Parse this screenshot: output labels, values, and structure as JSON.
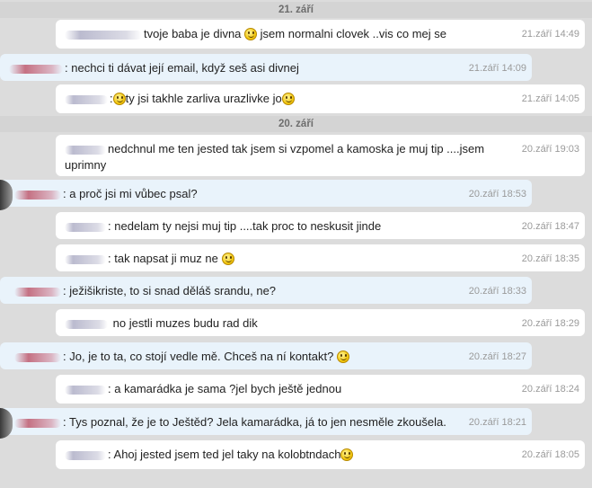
{
  "days": [
    {
      "label": "21. září"
    },
    {
      "label": "20. září"
    }
  ],
  "messages": [
    {
      "dir": "in",
      "prefix": "",
      "text": "tvoje baba je divna",
      "emoji_mid": true,
      "text2": "jsem normalni clovek ..vis co mej se",
      "time": "21.září 14:49"
    },
    {
      "dir": "out",
      "prefix": ":",
      "text": "nechci ti dávat její email, když seš asi divnej",
      "time": "21.září 14:09"
    },
    {
      "dir": "in",
      "prefix": ":",
      "text": "ty jsi takhle zarliva urazlivke jo",
      "time": "21.září 14:05"
    },
    {
      "dir": "in",
      "prefix": "",
      "text": "nedchnul me ten jested tak jsem si vzpomel a kamoska je muj tip ....jsem",
      "text_line2": "uprimny",
      "time": "20.září 19:03"
    },
    {
      "dir": "out",
      "prefix": ":",
      "text": "a proč jsi mi vůbec psal?",
      "time": "20.září 18:53"
    },
    {
      "dir": "in",
      "prefix": ":",
      "text": "nedelam ty nejsi muj tip ....tak proc to neskusit jinde",
      "time": "20.září 18:47"
    },
    {
      "dir": "in",
      "prefix": ":",
      "text": "tak napsat ji muz ne",
      "time": "20.září 18:35"
    },
    {
      "dir": "out",
      "prefix": ":",
      "text": "ježišikriste, to si snad děláš srandu, ne?",
      "time": "20.září 18:33"
    },
    {
      "dir": "in",
      "prefix": "",
      "text": "no jestli muzes budu rad dik",
      "time": "20.září 18:29"
    },
    {
      "dir": "out",
      "prefix": ":",
      "text": "Jo, je to ta, co stojí vedle mě. Chceš na ní kontakt?",
      "time": "20.září 18:27"
    },
    {
      "dir": "in",
      "prefix": ":",
      "text": "a kamarádka je sama ?jel bych ještě jednou",
      "time": "20.září 18:24"
    },
    {
      "dir": "out",
      "prefix": ":",
      "text": "Tys poznal, že je to Ještěd? Jela kamarádka, já to jen nesměle zkoušela.",
      "time": "20.září 18:21"
    },
    {
      "dir": "in",
      "prefix": ":",
      "text": "Ahoj jested jsem ted jel taky na kolobtndach",
      "time": "20.září 18:05"
    }
  ]
}
